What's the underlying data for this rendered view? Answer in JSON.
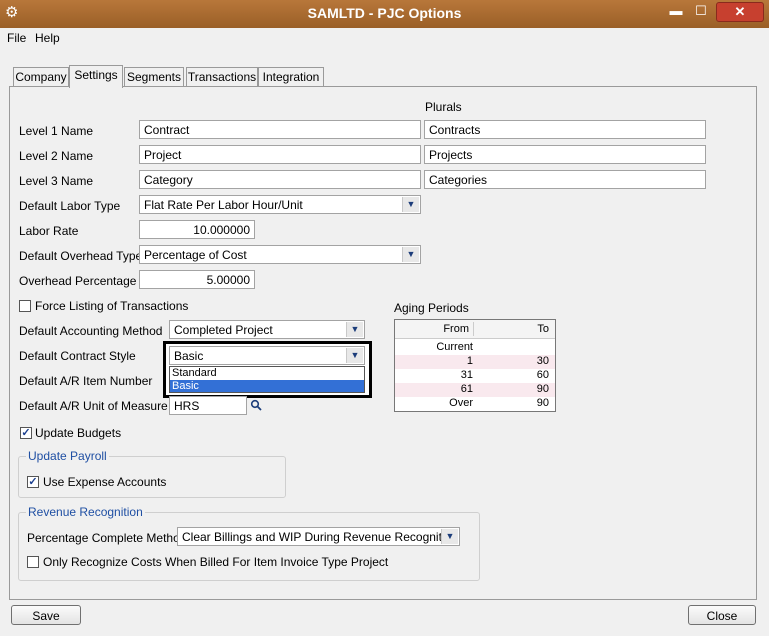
{
  "window": {
    "title": "SAMLTD - PJC Options",
    "minimize": "▬",
    "maximize": "☐",
    "close": "✕"
  },
  "menu": {
    "items": [
      "File",
      "Help"
    ]
  },
  "tabs": [
    "Company",
    "Settings",
    "Segments",
    "Transactions",
    "Integration"
  ],
  "active_tab": "Settings",
  "plurals_header": "Plurals",
  "levels": [
    {
      "label": "Level 1 Name",
      "name": "Contract",
      "plural": "Contracts"
    },
    {
      "label": "Level 2 Name",
      "name": "Project",
      "plural": "Projects"
    },
    {
      "label": "Level 3 Name",
      "name": "Category",
      "plural": "Categories"
    }
  ],
  "labor_type": {
    "label": "Default Labor Type",
    "value": "Flat Rate Per Labor Hour/Unit"
  },
  "labor_rate": {
    "label": "Labor Rate",
    "value": "10.000000"
  },
  "overhead_type": {
    "label": "Default Overhead Type",
    "value": "Percentage of Cost"
  },
  "overhead_pct": {
    "label": "Overhead Percentage",
    "value": "5.00000"
  },
  "force_listing": {
    "label": "Force Listing of Transactions",
    "checked": false
  },
  "accounting_method": {
    "label": "Default Accounting Method",
    "value": "Completed Project"
  },
  "contract_style": {
    "label": "Default Contract Style",
    "value": "Basic",
    "options": [
      "Standard",
      "Basic"
    ],
    "selected_option": "Basic"
  },
  "ar_item": {
    "label": "Default A/R Item Number"
  },
  "ar_uom": {
    "label": "Default A/R Unit of Measure",
    "value": "HRS"
  },
  "update_budgets": {
    "label": "Update Budgets",
    "checked": true
  },
  "payroll": {
    "title": "Update Payroll",
    "use_expense": {
      "label": "Use Expense Accounts",
      "checked": true
    }
  },
  "aging": {
    "title": "Aging Periods",
    "headers": [
      "From",
      "To"
    ],
    "rows": [
      {
        "from": "Current",
        "to": ""
      },
      {
        "from": "1",
        "to": "30"
      },
      {
        "from": "31",
        "to": "60"
      },
      {
        "from": "61",
        "to": "90"
      },
      {
        "from": "Over",
        "to": "90"
      }
    ]
  },
  "revenue": {
    "title": "Revenue Recognition",
    "method_label": "Percentage Complete Method",
    "method_value": "Clear Billings and WIP During Revenue Recognition",
    "only_costs": {
      "label": "Only Recognize Costs When Billed For Item Invoice Type Project",
      "checked": false
    }
  },
  "buttons": {
    "save": "Save",
    "close": "Close"
  }
}
